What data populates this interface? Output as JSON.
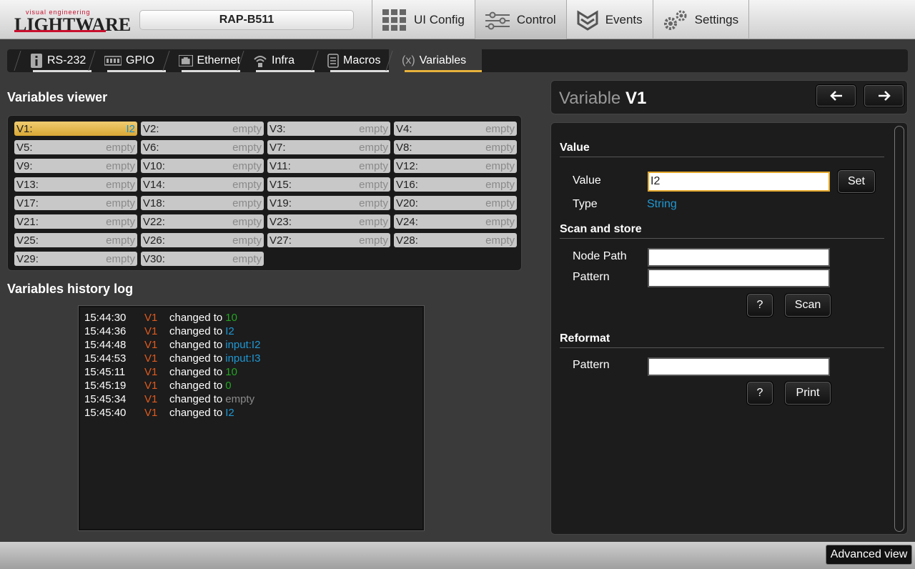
{
  "brand": {
    "tagline": "visual engineering",
    "name": "LIGHTWARE"
  },
  "device_name": "RAP-B511",
  "main_nav": [
    {
      "label": "UI Config",
      "icon": "grid-icon"
    },
    {
      "label": "Control",
      "icon": "sliders-icon",
      "active": true
    },
    {
      "label": "Events",
      "icon": "events-icon"
    },
    {
      "label": "Settings",
      "icon": "gears-icon"
    }
  ],
  "sub_tabs": [
    {
      "label": "RS-232",
      "icon": "info-icon"
    },
    {
      "label": "GPIO",
      "icon": "gpio-icon"
    },
    {
      "label": "Ethernet",
      "icon": "ethernet-icon"
    },
    {
      "label": "Infra",
      "icon": "infra-icon"
    },
    {
      "label": "Macros",
      "icon": "macros-icon"
    },
    {
      "label": "Variables",
      "icon": "variables-icon",
      "active": true
    }
  ],
  "viewer": {
    "title": "Variables viewer",
    "variables": [
      {
        "name": "V1:",
        "value": "I2",
        "selected": true
      },
      {
        "name": "V2:",
        "value": "empty"
      },
      {
        "name": "V3:",
        "value": "empty"
      },
      {
        "name": "V4:",
        "value": "empty"
      },
      {
        "name": "V5:",
        "value": "empty"
      },
      {
        "name": "V6:",
        "value": "empty"
      },
      {
        "name": "V7:",
        "value": "empty"
      },
      {
        "name": "V8:",
        "value": "empty"
      },
      {
        "name": "V9:",
        "value": "empty"
      },
      {
        "name": "V10:",
        "value": "empty"
      },
      {
        "name": "V11:",
        "value": "empty"
      },
      {
        "name": "V12:",
        "value": "empty"
      },
      {
        "name": "V13:",
        "value": "empty"
      },
      {
        "name": "V14:",
        "value": "empty"
      },
      {
        "name": "V15:",
        "value": "empty"
      },
      {
        "name": "V16:",
        "value": "empty"
      },
      {
        "name": "V17:",
        "value": "empty"
      },
      {
        "name": "V18:",
        "value": "empty"
      },
      {
        "name": "V19:",
        "value": "empty"
      },
      {
        "name": "V20:",
        "value": "empty"
      },
      {
        "name": "V21:",
        "value": "empty"
      },
      {
        "name": "V22:",
        "value": "empty"
      },
      {
        "name": "V23:",
        "value": "empty"
      },
      {
        "name": "V24:",
        "value": "empty"
      },
      {
        "name": "V25:",
        "value": "empty"
      },
      {
        "name": "V26:",
        "value": "empty"
      },
      {
        "name": "V27:",
        "value": "empty"
      },
      {
        "name": "V28:",
        "value": "empty"
      },
      {
        "name": "V29:",
        "value": "empty"
      },
      {
        "name": "V30:",
        "value": "empty"
      }
    ]
  },
  "history": {
    "title": "Variables history log",
    "changed_label": "changed to",
    "entries": [
      {
        "time": "15:44:30",
        "var": "V1",
        "value": "10",
        "color": "#22a422"
      },
      {
        "time": "15:44:36",
        "var": "V1",
        "value": "I2",
        "color": "#1f98d3"
      },
      {
        "time": "15:44:48",
        "var": "V1",
        "value": "input:I2",
        "color": "#1f98d3"
      },
      {
        "time": "15:44:53",
        "var": "V1",
        "value": "input:I3",
        "color": "#1f98d3"
      },
      {
        "time": "15:45:11",
        "var": "V1",
        "value": "10",
        "color": "#22a422"
      },
      {
        "time": "15:45:19",
        "var": "V1",
        "value": "0",
        "color": "#22a422"
      },
      {
        "time": "15:45:34",
        "var": "V1",
        "value": "empty",
        "color": "#8a8a8a"
      },
      {
        "time": "15:45:40",
        "var": "V1",
        "value": "I2",
        "color": "#1f98d3"
      }
    ]
  },
  "detail": {
    "title_prefix": "Variable",
    "title_var": "V1",
    "prev_label": "🡐",
    "next_label": "🡒",
    "value_section": "Value",
    "value_label": "Value",
    "value_input": "I2",
    "set_label": "Set",
    "type_label": "Type",
    "type_value": "String",
    "scan_section": "Scan and store",
    "node_path_label": "Node Path",
    "node_path_value": "",
    "pattern_label": "Pattern",
    "pattern_value": "",
    "help_label": "?",
    "scan_label": "Scan",
    "reformat_section": "Reformat",
    "reformat_pattern_label": "Pattern",
    "reformat_pattern_value": "",
    "print_label": "Print"
  },
  "advanced_view_label": "Advanced view"
}
